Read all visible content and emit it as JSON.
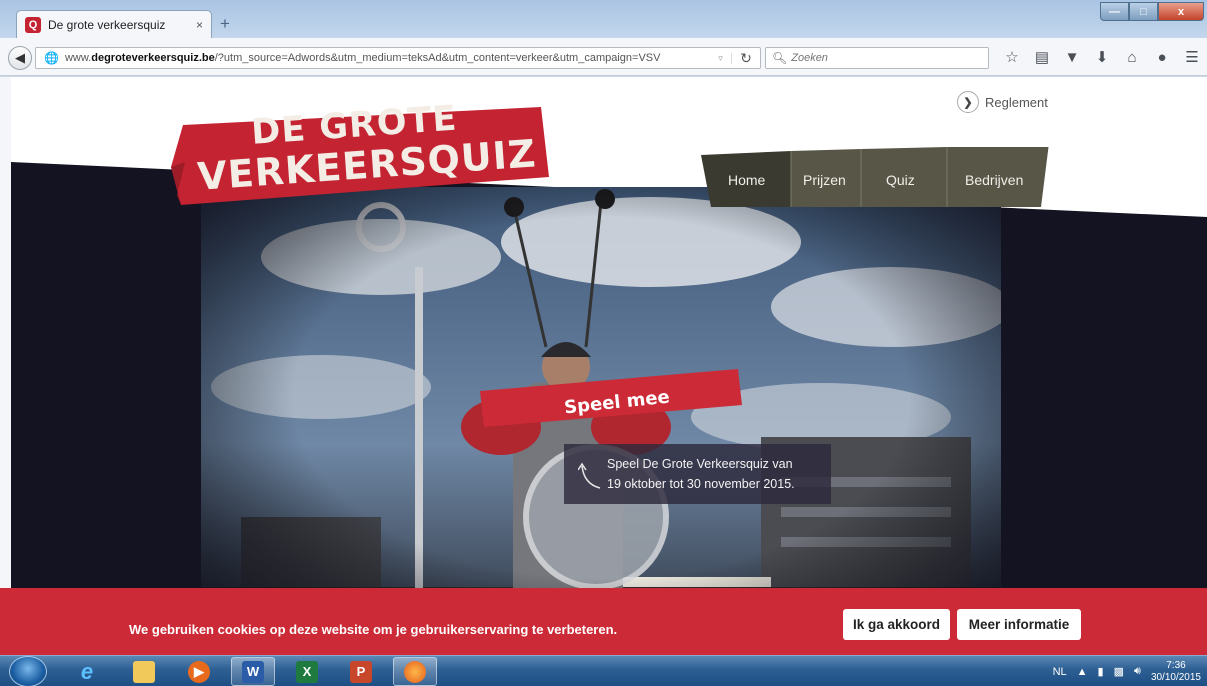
{
  "browser": {
    "tab_title": "De grote verkeersquiz",
    "tab_favicon": "Q",
    "tab_close": "×",
    "new_tab": "+",
    "url_prefix": "www.",
    "url_domain": "degroteverkeersquiz.be",
    "url_rest": "/?utm_source=Adwords&utm_medium=teksAd&utm_content=verkeer&utm_campaign=VSV",
    "search_placeholder": "Zoeken",
    "toolbar_icons": [
      "star-icon",
      "reading-list-icon",
      "pocket-icon",
      "download-icon",
      "home-icon",
      "chat-icon",
      "menu-icon"
    ],
    "window_controls": {
      "minimize": "—",
      "maximize": "□",
      "close": "x"
    }
  },
  "site": {
    "logo_line1": "DE GROTE",
    "logo_line2": "VERKEERSQUIZ",
    "reglement_label": "Reglement",
    "nav": [
      {
        "label": "Home",
        "active": true
      },
      {
        "label": "Prijzen",
        "active": false
      },
      {
        "label": "Quiz",
        "active": false
      },
      {
        "label": "Bedrijven",
        "active": false
      }
    ],
    "cta_label": "Speel mee",
    "dates_line1": "Speel De Grote Verkeersquiz van",
    "dates_line2": "19 oktober tot 30 november 2015.",
    "colors": {
      "brand_red": "#cc2a36",
      "nav_bg": "#575647",
      "nav_active": "#3a3a30",
      "hero_dark": "#131322"
    }
  },
  "cookie": {
    "message": "We gebruiken cookies op deze website om je gebruikerservaring te verbeteren.",
    "accept_label": "Ik ga akkoord",
    "more_info_label": "Meer informatie"
  },
  "taskbar": {
    "items": [
      "internet-explorer-icon",
      "file-explorer-icon",
      "media-player-icon",
      "word-icon",
      "excel-icon",
      "powerpoint-icon",
      "firefox-icon"
    ],
    "language": "NL",
    "time": "7:36",
    "date": "30/10/2015"
  }
}
